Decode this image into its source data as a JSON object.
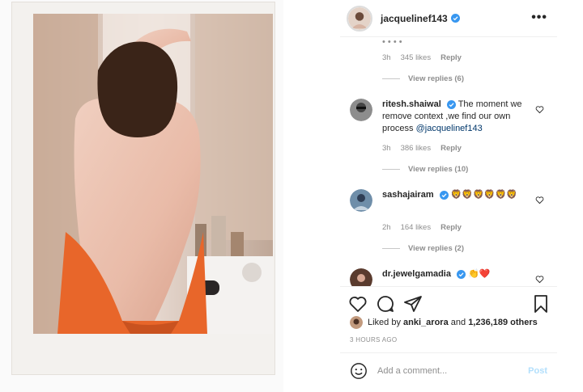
{
  "post": {
    "username": "jacquelinef143",
    "more_icon": "more-options-icon"
  },
  "comments": {
    "truncated_text": "• • • •",
    "first_meta": {
      "time": "3h",
      "likes": "345 likes",
      "reply": "Reply"
    },
    "first_replies": "View replies (6)",
    "items": [
      {
        "username": "ritesh.shaiwal",
        "text": "The moment we remove context ,we find our own process",
        "mention": "@jacquelinef143",
        "time": "3h",
        "likes": "386 likes",
        "reply": "Reply",
        "replies": "View replies (10)"
      },
      {
        "username": "sashajairam",
        "text": "🦁🦁🦁🦁🦁🦁",
        "time": "2h",
        "likes": "164 likes",
        "reply": "Reply",
        "replies": "View replies (2)"
      },
      {
        "username": "dr.jewelgamadia",
        "text": "👏❤️"
      }
    ]
  },
  "likes": {
    "prefix": "Liked by",
    "user": "anki_arora",
    "and": "and",
    "others": "1,236,189 others"
  },
  "timestamp": "3 HOURS AGO",
  "add_comment": {
    "placeholder": "Add a comment...",
    "post_label": "Post"
  },
  "colors": {
    "verified": "#3897f0",
    "post_disabled": "#b2dffc",
    "towel": "#e8662a"
  }
}
